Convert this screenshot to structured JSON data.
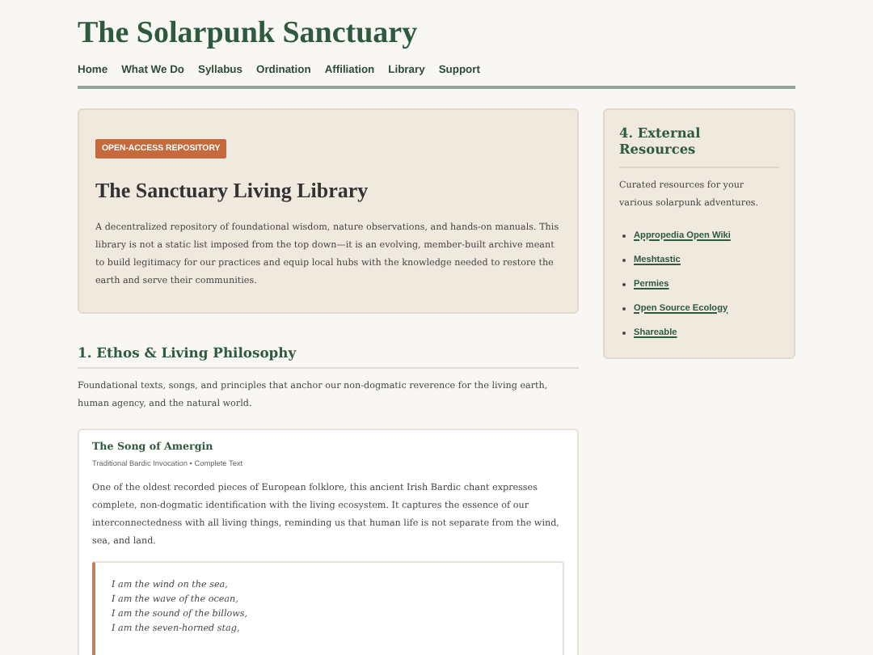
{
  "site_title": "The Solarpunk Sanctuary",
  "nav": [
    {
      "label": "Home"
    },
    {
      "label": "What We Do"
    },
    {
      "label": "Syllabus"
    },
    {
      "label": "Ordination"
    },
    {
      "label": "Affiliation"
    },
    {
      "label": "Library"
    },
    {
      "label": "Support"
    }
  ],
  "hero": {
    "badge": "OPEN-ACCESS REPOSITORY",
    "title": "The Sanctuary Living Library",
    "text": "A decentralized repository of foundational wisdom, nature observations, and hands-on manuals. This library is not a static list imposed from the top down—it is an evolving, member-built archive meant to build legitimacy for our practices and equip local hubs with the knowledge needed to restore the earth and serve their communities."
  },
  "section": {
    "heading": "1. Ethos & Living Philosophy",
    "intro": "Foundational texts, songs, and principles that anchor our non-dogmatic reverence for the living earth, human agency, and the natural world."
  },
  "entry": {
    "title": "The Song of Amergin",
    "meta": "Traditional Bardic Invocation • Complete Text",
    "text": "One of the oldest recorded pieces of European folklore, this ancient Irish Bardic chant expresses complete, non-dogmatic identification with the living ecosystem. It captures the essence of our interconnectedness with all living things, reminding us that human life is not separate from the wind, sea, and land.",
    "verse": [
      "I am the wind on the sea,",
      "I am the wave of the ocean,",
      "I am the sound of the billows,",
      "I am the seven-horned stag,"
    ]
  },
  "sidebar": {
    "heading": "4. External Resources",
    "text": "Curated resources for your various solarpunk adventures.",
    "links": [
      {
        "label": "Appropedia Open Wiki"
      },
      {
        "label": "Meshtastic"
      },
      {
        "label": "Permies"
      },
      {
        "label": "Open Source Ecology"
      },
      {
        "label": "Shareable"
      }
    ]
  }
}
